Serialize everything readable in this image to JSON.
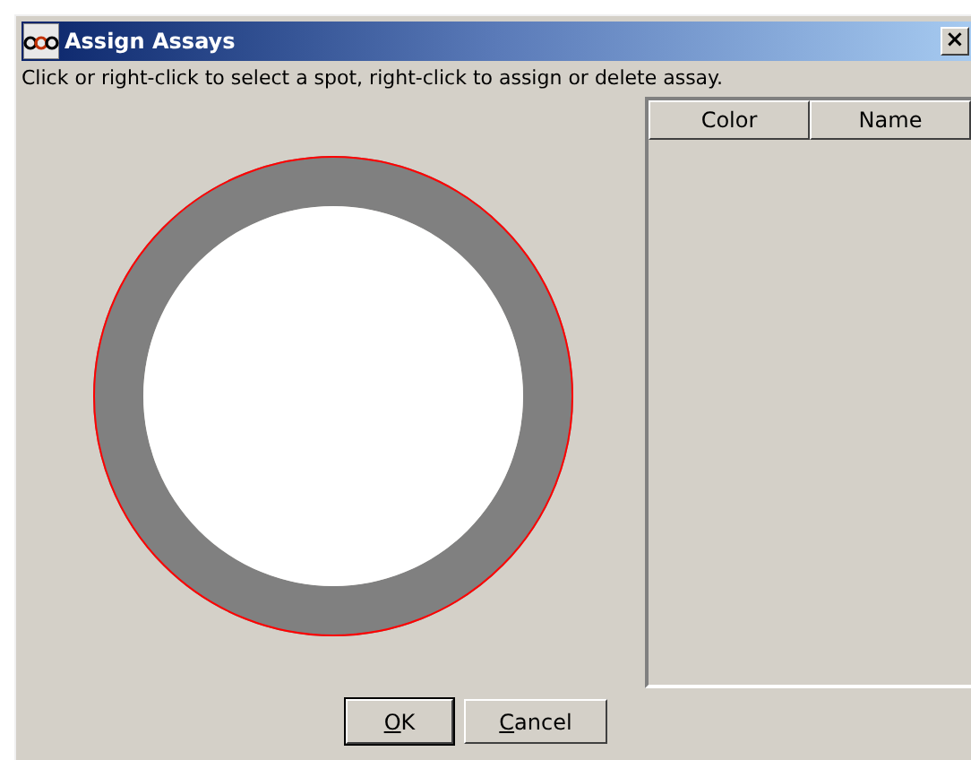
{
  "window": {
    "title": "Assign Assays",
    "close": "×"
  },
  "instruction": "Click or right-click to select a spot, right-click to assign or delete assay.",
  "table": {
    "columns": [
      "Color",
      "Name"
    ]
  },
  "buttons": [
    {
      "mnemonic": "O",
      "rest": "K"
    },
    {
      "mnemonic": "C",
      "rest": "ancel"
    }
  ]
}
